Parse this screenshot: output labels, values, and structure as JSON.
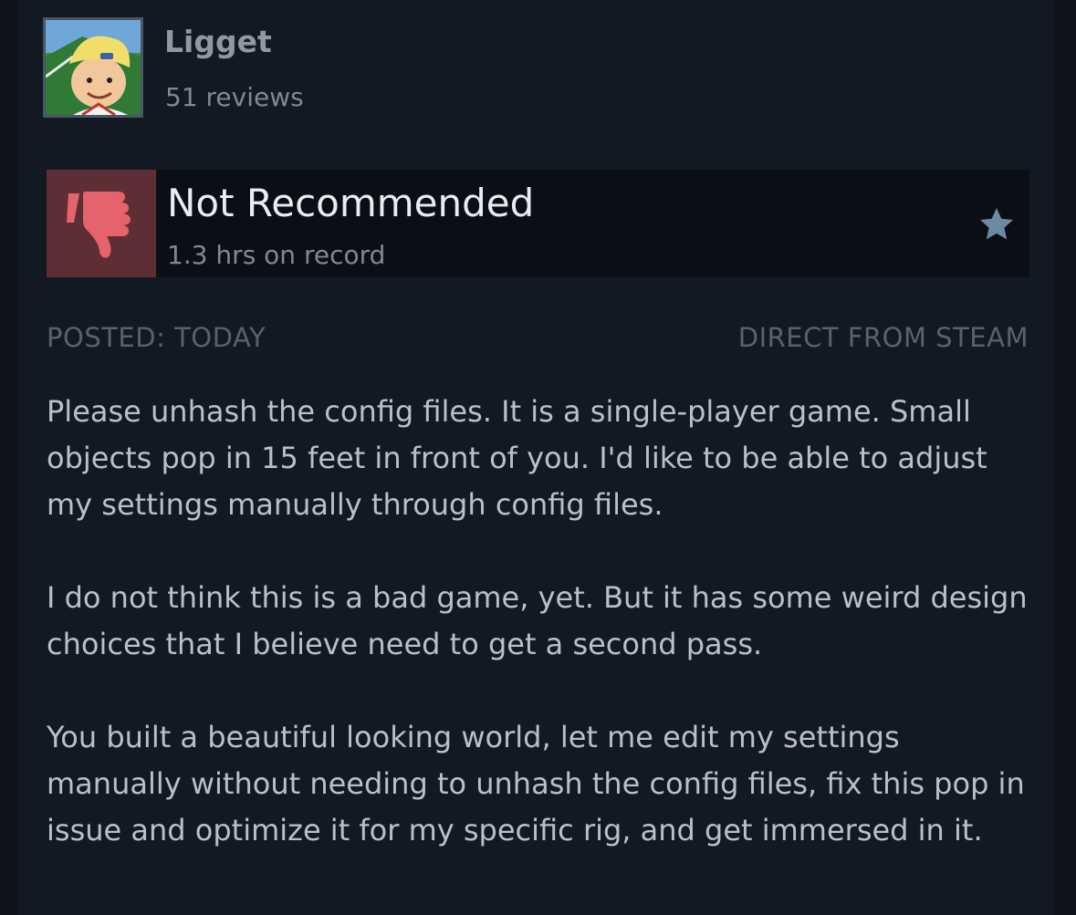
{
  "reviewer": {
    "name": "Ligget",
    "review_count": "51 reviews"
  },
  "rating": {
    "verdict": "Not Recommended",
    "playtime": "1.3 hrs on record",
    "thumb_icon": "thumbs-down-icon",
    "award_icon": "star-icon"
  },
  "meta": {
    "posted": "POSTED: TODAY",
    "source": "DIRECT FROM STEAM"
  },
  "review": {
    "paragraphs": [
      "Please unhash the config files. It is a single-player game. Small objects pop in 15 feet in front of you. I'd like to be able to adjust my settings manually through config files.",
      "I do not think this is a bad game, yet. But it has some weird design choices that I believe need to get a second pass.",
      "You built a beautiful looking world, let me edit my settings manually without needing to unhash the config files, fix this pop in issue and optimize it for my specific rig, and get immersed in it."
    ]
  },
  "colors": {
    "background": "#0e131a",
    "card": "#131922",
    "thumb_box": "#5d2f34",
    "thumb_icon": "#e5636a",
    "star": "#6d8aa5",
    "verdict_text": "#e9edf2",
    "body_text": "#b9c0c8",
    "muted_text": "#596170"
  }
}
